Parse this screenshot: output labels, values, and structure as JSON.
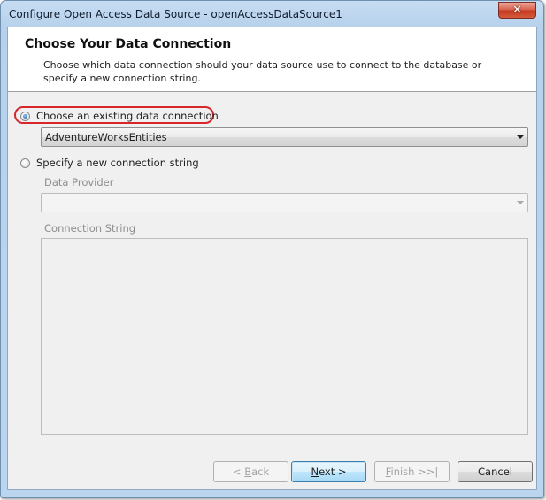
{
  "window": {
    "title": "Configure Open Access Data Source - openAccessDataSource1",
    "close_glyph": "✕"
  },
  "header": {
    "title": "Choose Your Data Connection",
    "description": "Choose which data connection should your data source use to connect to the database or specify a new connection string."
  },
  "options": {
    "existing_label": "Choose an existing data connection",
    "existing_selected": true,
    "existing_connection_value": "AdventureWorksEntities",
    "new_label": "Specify a new connection string",
    "new_selected": false
  },
  "fields": {
    "data_provider_label": "Data Provider",
    "data_provider_value": "",
    "connection_string_label": "Connection String",
    "connection_string_value": ""
  },
  "buttons": {
    "back": {
      "prefix": "< ",
      "mnemonic": "B",
      "rest": "ack",
      "enabled": false
    },
    "next": {
      "mnemonic": "N",
      "rest": "ext >",
      "enabled": true
    },
    "finish": {
      "mnemonic": "F",
      "rest": "inish >>|",
      "enabled": false
    },
    "cancel": {
      "label": "Cancel",
      "enabled": true
    }
  },
  "colors": {
    "highlight_ring": "#d6272c",
    "window_frame": "#b7d1ec",
    "default_button_border": "#3c7fb1"
  }
}
